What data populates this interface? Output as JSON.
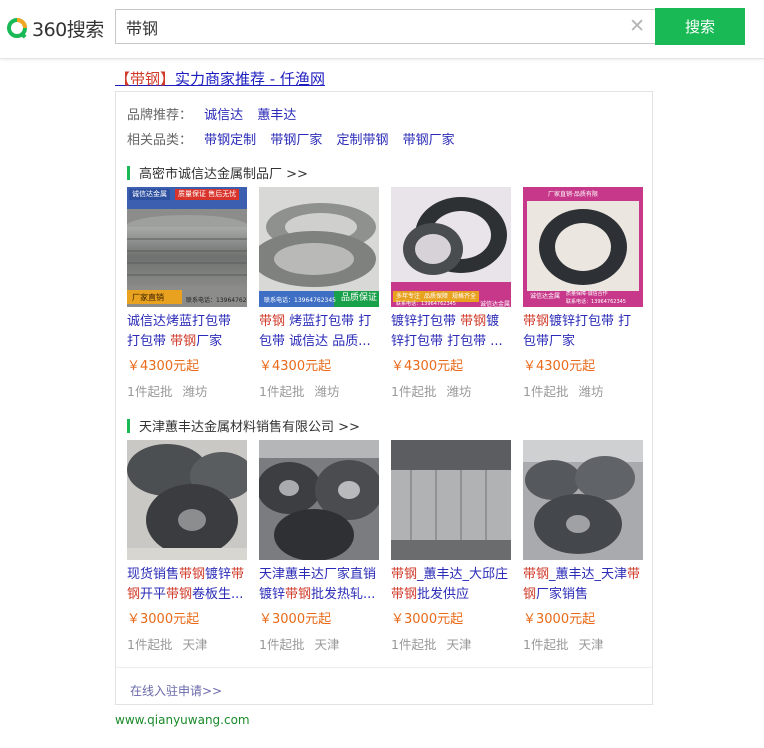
{
  "logo": {
    "text": "360搜索"
  },
  "search": {
    "value": "带钢",
    "button": "搜索"
  },
  "result": {
    "title_hl": "【带钢】",
    "title_rest": "实力商家推荐 - 仟渔网",
    "brand_label": "品牌推荐：",
    "brands": [
      "诚信达",
      "蕙丰达"
    ],
    "related_label": "相关品类：",
    "related": [
      "带钢定制",
      "带钢厂家",
      "定制带钢",
      "带钢厂家"
    ]
  },
  "shops": [
    {
      "name": "高密市诚信达金属制品厂 >>",
      "products": [
        {
          "name_parts": [
            [
              "诚信达烤蓝打包带",
              0
            ],
            [
              "\n打包带 ",
              0
            ],
            [
              "带钢",
              1
            ],
            [
              "厂家",
              0
            ]
          ],
          "price": "￥4300元起",
          "moq": "1件起批",
          "city": "潍坊",
          "banner": [
            "诚信达金属",
            "质量保证 售后无忧",
            "厂家直销",
            "联系电话：13964762345"
          ]
        },
        {
          "name_parts": [
            [
              "带钢",
              1
            ],
            [
              " 烤蓝打包带 打包带 诚信达 品质...",
              0
            ]
          ],
          "price": "￥4300元起",
          "moq": "1件起批",
          "city": "潍坊",
          "banner": [
            "联系电话：13964762345",
            "品质保证"
          ]
        },
        {
          "name_parts": [
            [
              "镀锌打包带 ",
              0
            ],
            [
              "带钢",
              1
            ],
            [
              "镀锌打包带 打包带 ...",
              0
            ]
          ],
          "price": "￥4300元起",
          "moq": "1件起批",
          "city": "潍坊",
          "banner": [
            "多年专注",
            "品质保障",
            "规格齐全",
            "诚信达金属",
            "联系电话：13964762345"
          ]
        },
        {
          "name_parts": [
            [
              "带钢",
              1
            ],
            [
              "镀锌打包带 打包带厂家",
              0
            ]
          ],
          "price": "￥4300元起",
          "moq": "1件起批",
          "city": "潍坊",
          "banner": [
            "厂家直销·品质有限",
            "诚信达金属",
            "质量保障·诚信合作",
            "联系电话：13964762345"
          ]
        }
      ]
    },
    {
      "name": "天津蕙丰达金属材料销售有限公司 >>",
      "products": [
        {
          "name_parts": [
            [
              "现货销售",
              0
            ],
            [
              "带钢",
              1
            ],
            [
              "镀锌",
              0
            ],
            [
              "带钢",
              1
            ],
            [
              "开平",
              0
            ],
            [
              "带钢",
              1
            ],
            [
              "卷板生...",
              0
            ]
          ],
          "price": "￥3000元起",
          "moq": "1件起批",
          "city": "天津"
        },
        {
          "name_parts": [
            [
              "天津蕙丰达厂家直销镀锌",
              0
            ],
            [
              "带钢",
              1
            ],
            [
              "批发热轧...",
              0
            ]
          ],
          "price": "￥3000元起",
          "moq": "1件起批",
          "city": "天津"
        },
        {
          "name_parts": [
            [
              "带钢",
              1
            ],
            [
              "_蕙丰达_大邱庄",
              0
            ],
            [
              "带钢",
              1
            ],
            [
              "批发供应",
              0
            ]
          ],
          "price": "￥3000元起",
          "moq": "1件起批",
          "city": "天津"
        },
        {
          "name_parts": [
            [
              "带钢",
              1
            ],
            [
              "_蕙丰达_天津",
              0
            ],
            [
              "带钢",
              1
            ],
            [
              "厂家销售",
              0
            ]
          ],
          "price": "￥3000元起",
          "moq": "1件起批",
          "city": "天津"
        }
      ]
    }
  ],
  "footer": {
    "apply_link": "在线入驻申请>>",
    "url": "www.qianyuwang.com"
  },
  "colors": {
    "accent": "#19b955",
    "link": "#2b2bb8",
    "highlight": "#d03b2a",
    "price": "#e96a1a"
  }
}
